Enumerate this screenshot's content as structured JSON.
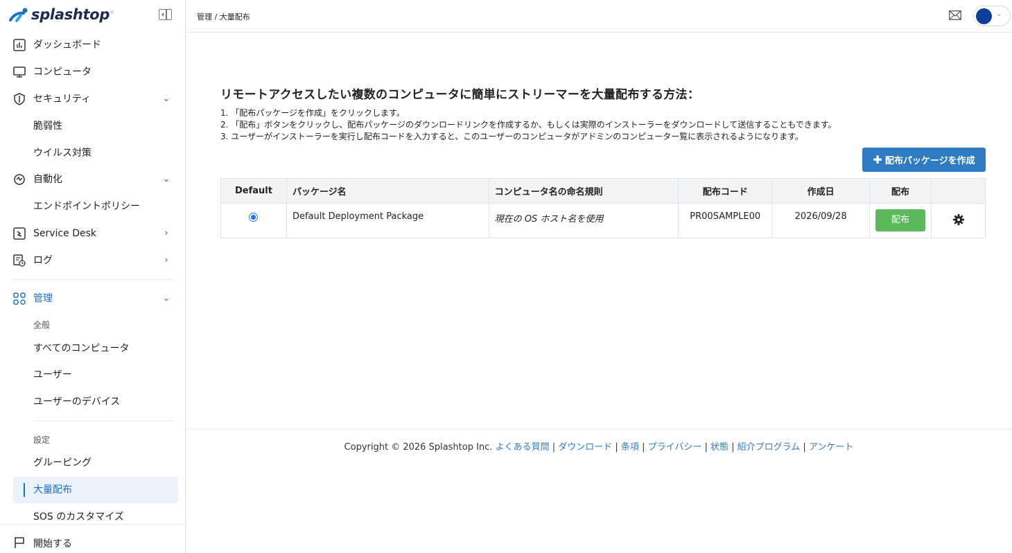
{
  "brand": {
    "name": "splashtop",
    "mark": "®"
  },
  "sidebar": {
    "items": [
      {
        "label": "ダッシュボード"
      },
      {
        "label": "コンピュータ"
      },
      {
        "label": "セキュリティ",
        "chevron": "⌄"
      },
      {
        "label": "脆弱性"
      },
      {
        "label": "ウイルス対策"
      },
      {
        "label": "自動化",
        "chevron": "⌄"
      },
      {
        "label": "エンドポイントポリシー"
      },
      {
        "label": "Service Desk",
        "chevron": "›"
      },
      {
        "label": "ログ",
        "chevron": "›"
      },
      {
        "label": "管理",
        "chevron": "⌄"
      }
    ],
    "admin": {
      "section_general": "全般",
      "all_computers": "すべてのコンピュータ",
      "users": "ユーザー",
      "user_devices": "ユーザーのデバイス",
      "section_settings": "設定",
      "grouping": "グルーピング",
      "mass_deployment": "大量配布",
      "sos_customize": "SOS のカスタマイズ"
    },
    "footer_label": "開始する"
  },
  "topbar": {
    "breadcrumb": "管理 / 大量配布",
    "avatar_color": "#0d3f9a"
  },
  "main": {
    "heading": "リモートアクセスしたい複数のコンピュータに簡単にストリーマーを大量配布する方法：",
    "steps": [
      "1. 「配布パッケージを作成」をクリックします。",
      "2. 「配布」ボタンをクリックし、配布パッケージのダウンロードリンクを作成するか、もしくは実際のインストーラーをダウンロードして送信することもできます。",
      "3. ユーザーがインストーラーを実行し配布コードを入力すると、このユーザーのコンピュータがアドミンのコンピューター覧に表示されるようになります。"
    ],
    "create_button": "配布パッケージを作成",
    "table": {
      "headers": [
        "Default",
        "パッケージ名",
        "コンピュータ名の命名規則",
        "配布コード",
        "作成日",
        "配布",
        ""
      ],
      "rows": [
        {
          "default": true,
          "package_name": "Default Deployment Package",
          "naming_rule": "現在の OS ホスト名を使用",
          "code": "PR00SAMPLE00",
          "created": "2026/09/28",
          "deploy_label": "配布"
        }
      ]
    }
  },
  "footer": {
    "copyright": "Copyright © 2026 Splashtop Inc.",
    "links": [
      "よくある質問",
      "ダウンロード",
      "条項",
      "プライバシー",
      "状態",
      "紹介プログラム",
      "アンケート"
    ]
  }
}
